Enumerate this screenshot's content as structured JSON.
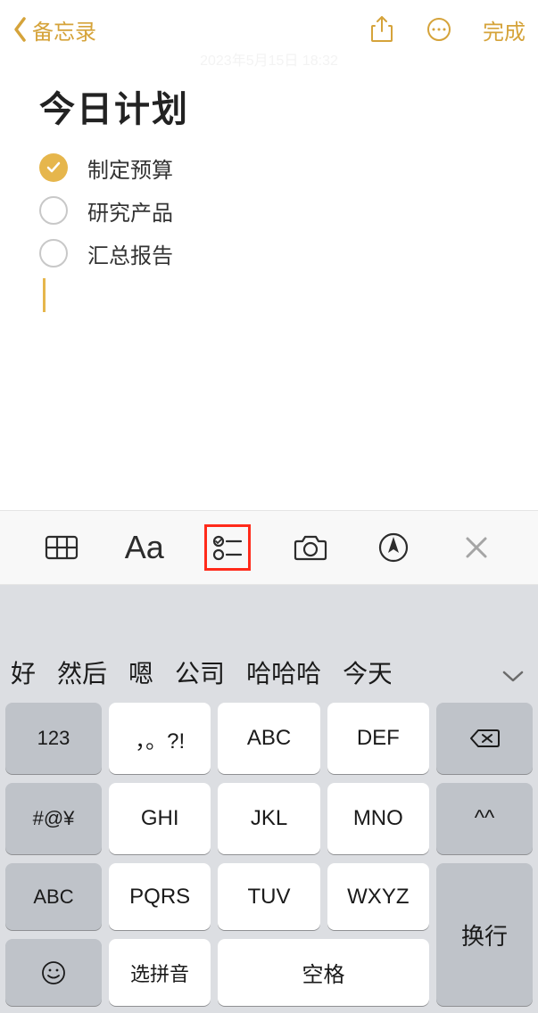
{
  "nav": {
    "back_label": "备忘录",
    "done_label": "完成"
  },
  "timestamp": "2023年5月15日 18:32",
  "note": {
    "title": "今日计划",
    "items": [
      {
        "label": "制定预算",
        "checked": true
      },
      {
        "label": "研究产品",
        "checked": false
      },
      {
        "label": "汇总报告",
        "checked": false
      }
    ]
  },
  "fmt": {
    "aa_label": "Aa"
  },
  "candidates": {
    "items": [
      "好",
      "然后",
      "嗯",
      "公司",
      "哈哈哈",
      "今天"
    ]
  },
  "keys": {
    "r1": {
      "side_l": "123",
      "c1": "，。?!",
      "c2": "ABC",
      "c3": "DEF"
    },
    "r2": {
      "side_l": "#@¥",
      "c1": "GHI",
      "c2": "JKL",
      "c3": "MNO",
      "side_r": "^^"
    },
    "r3": {
      "side_l": "ABC",
      "c1": "PQRS",
      "c2": "TUV",
      "c3": "WXYZ"
    },
    "r4": {
      "c_py": "选拼音",
      "c_space": "空格",
      "return": "换行"
    }
  }
}
